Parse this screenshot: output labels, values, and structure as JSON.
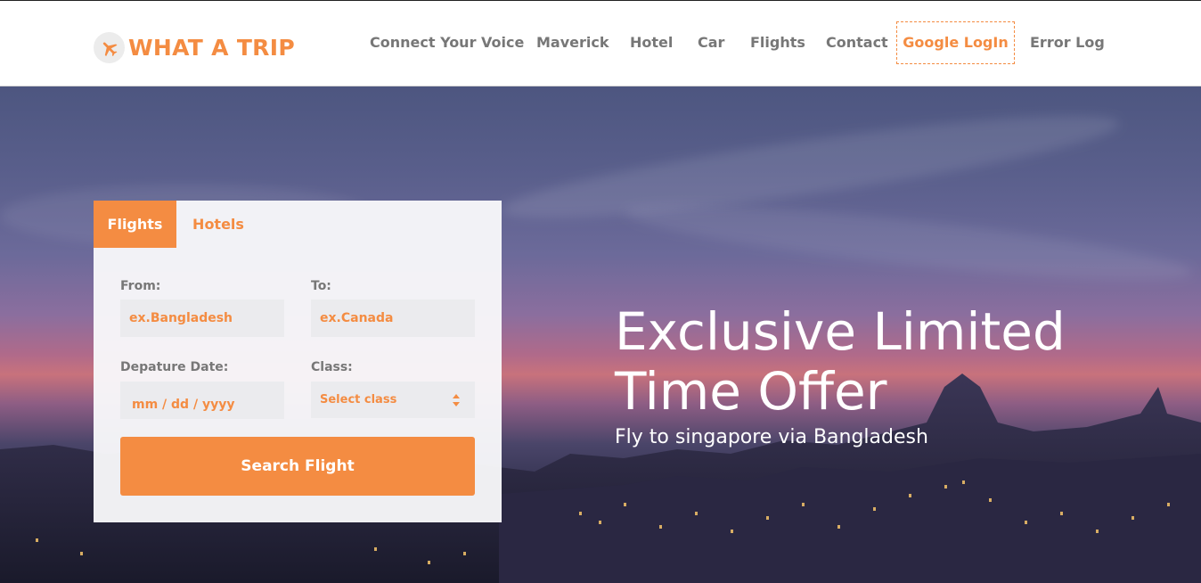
{
  "brand": {
    "name": "WHAT A TRIP",
    "icon": "airplane-icon",
    "color": "#f48c42"
  },
  "nav": {
    "items": [
      {
        "label": "Connect Your Voice"
      },
      {
        "label": "Maverick"
      },
      {
        "label": "Hotel"
      },
      {
        "label": "Car"
      },
      {
        "label": "Flights"
      },
      {
        "label": "Contact"
      },
      {
        "label": "Google LogIn",
        "active": true
      },
      {
        "label": "Error Log"
      }
    ]
  },
  "search": {
    "tabs": [
      {
        "label": "Flights",
        "active": true
      },
      {
        "label": "Hotels",
        "active": false
      }
    ],
    "from_label": "From:",
    "from_placeholder": "ex.Bangladesh",
    "to_label": "To:",
    "to_placeholder": "ex.Canada",
    "date_label": "Depature Date:",
    "date_placeholder": "mm / dd / yyyy",
    "class_label": "Class:",
    "class_selected": "Select class",
    "button_label": "Search Flight"
  },
  "hero": {
    "title": "Exclusive Limited Time Offer",
    "subtitle": "Fly to singapore via Bangladesh"
  },
  "colors": {
    "accent": "#f48c42",
    "nav_text": "#777777"
  }
}
